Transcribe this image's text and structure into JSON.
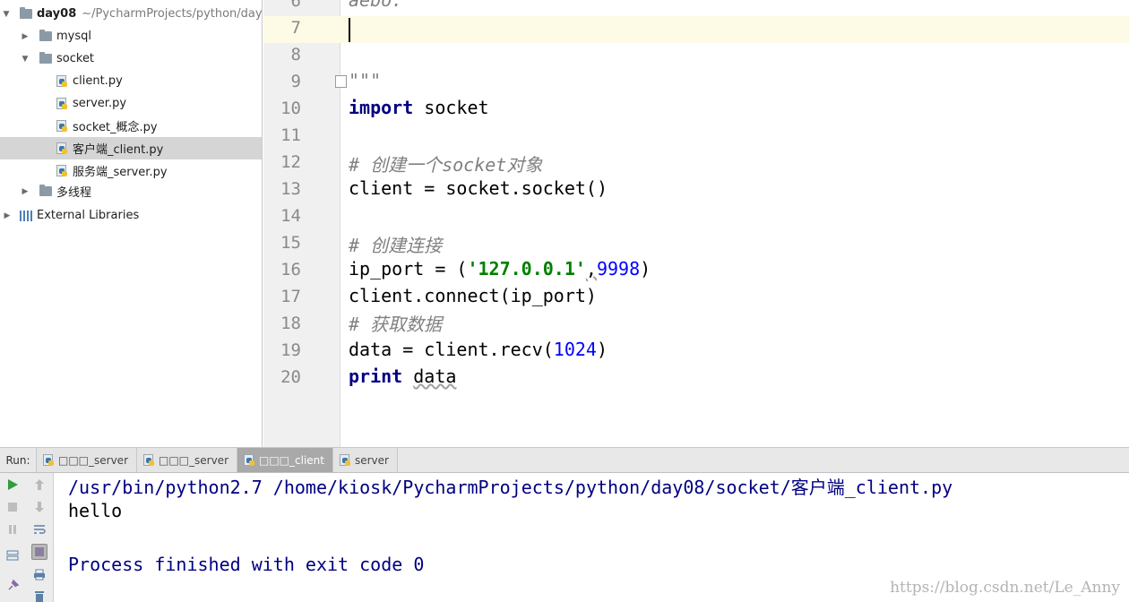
{
  "project_tree": {
    "root_name": "day08",
    "root_path": "~/PycharmProjects/python/day",
    "items": [
      {
        "label": "mysql"
      },
      {
        "label": "socket"
      },
      {
        "label": "client.py"
      },
      {
        "label": "server.py"
      },
      {
        "label": "socket_概念.py"
      },
      {
        "label": "客户端_client.py"
      },
      {
        "label": "服务端_server.py"
      },
      {
        "label": "多线程"
      },
      {
        "label": "External Libraries"
      }
    ]
  },
  "editor": {
    "line_numbers": [
      "6",
      "7",
      "8",
      "9",
      "10",
      "11",
      "12",
      "13",
      "14",
      "15",
      "16",
      "17",
      "18",
      "19",
      "20"
    ],
    "lines": {
      "l6": "aebo:",
      "l9": "\"\"\"",
      "l10_kw": "import",
      "l10_rest": " socket",
      "l12": "# 创建一个socket对象",
      "l13": "client = socket.socket()",
      "l15": "# 创建连接",
      "l16_a": "ip_port = (",
      "l16_str": "'127.0.0.1'",
      "l16_b": ",",
      "l16_num": "9998",
      "l16_c": ")",
      "l17": "client.connect(ip_port)",
      "l18": "# 获取数据",
      "l19_a": "data = client.recv(",
      "l19_num": "1024",
      "l19_b": ")",
      "l20_kw": "print",
      "l20_sp": " ",
      "l20_rest": "data"
    }
  },
  "run_panel": {
    "label": "Run:",
    "tabs": [
      {
        "label": "□□□_server",
        "active": false
      },
      {
        "label": "□□□_server",
        "active": false
      },
      {
        "label": "□□□_client",
        "active": true
      },
      {
        "label": "server",
        "active": false
      }
    ],
    "console": {
      "command": "/usr/bin/python2.7 /home/kiosk/PycharmProjects/python/day08/socket/客户端_client.py",
      "output": "hello",
      "exit": "Process finished with exit code 0"
    },
    "watermark": "https://blog.csdn.net/Le_Anny"
  },
  "colors": {
    "keyword": "#000080",
    "string": "#008000",
    "number": "#0000ff",
    "comment": "#808080",
    "caret_line": "#fdfae6",
    "run_button": "#2e9e3e"
  }
}
